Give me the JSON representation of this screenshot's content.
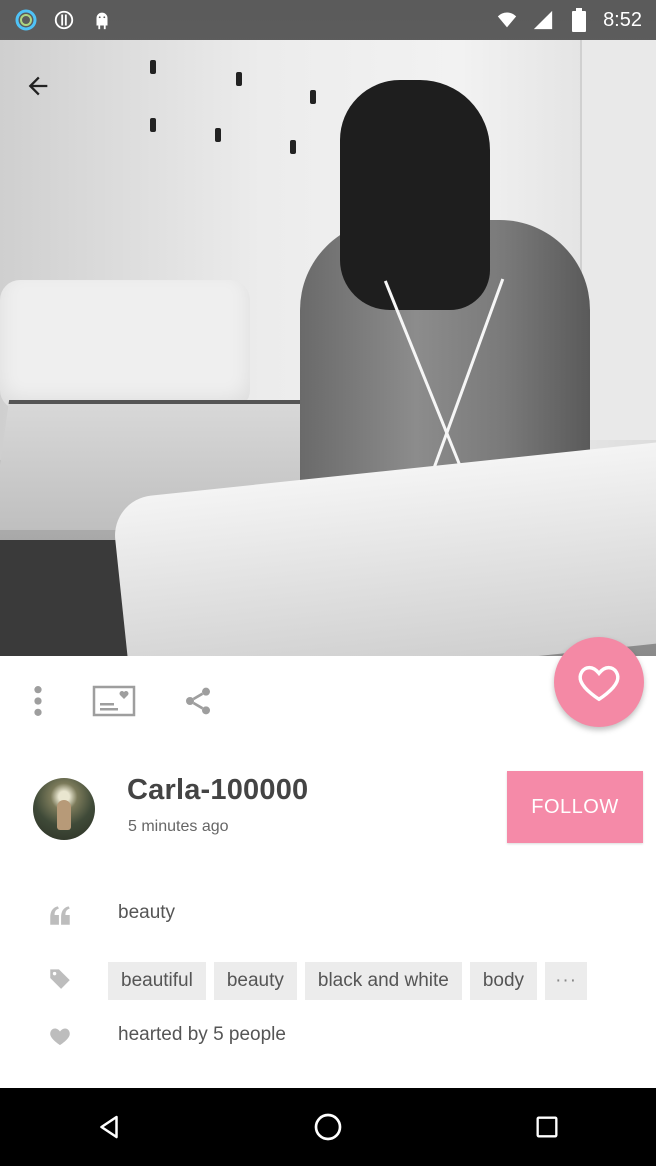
{
  "status_bar": {
    "time": "8:52",
    "icons": [
      "ring-app-icon",
      "alert-icon",
      "android-icon",
      "wifi-icon",
      "signal-icon",
      "battery-icon"
    ]
  },
  "photo": {
    "style": "black-and-white"
  },
  "post": {
    "author": "Carla-100000",
    "time_ago": "5 minutes ago",
    "follow_label": "FOLLOW",
    "caption": "beauty",
    "tags": [
      "beautiful",
      "beauty",
      "black and white",
      "body"
    ],
    "tags_more": "···",
    "hearted_text": "hearted by 5 people"
  },
  "actions": {
    "icons": [
      "more-vertical-icon",
      "add-to-collection-icon",
      "share-icon",
      "heart-icon"
    ]
  },
  "colors": {
    "accent_pink": "#f58aa8",
    "icon_gray": "#9e9e9e",
    "text_dark": "#444444"
  }
}
